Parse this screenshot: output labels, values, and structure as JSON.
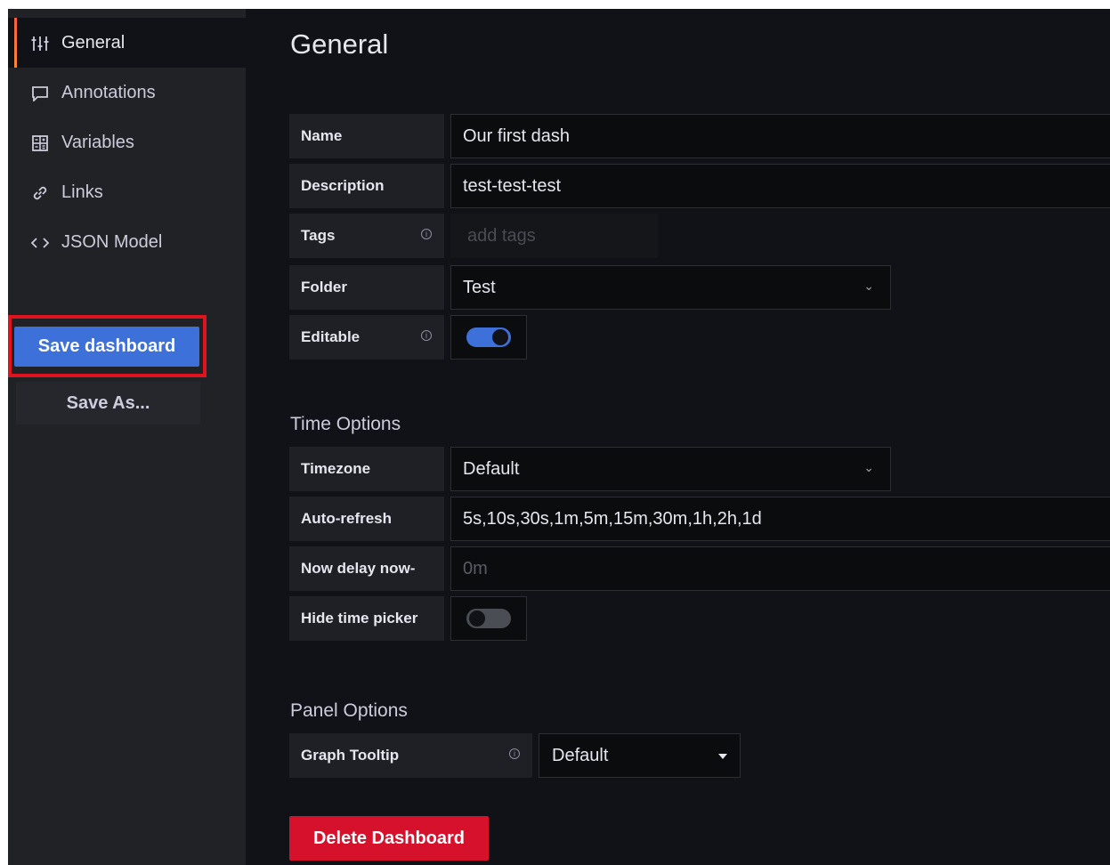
{
  "sidebar": {
    "items": [
      {
        "label": "General",
        "icon": "sliders-icon",
        "active": true
      },
      {
        "label": "Annotations",
        "icon": "comment-icon"
      },
      {
        "label": "Variables",
        "icon": "calculator-icon"
      },
      {
        "label": "Links",
        "icon": "link-icon"
      },
      {
        "label": "JSON Model",
        "icon": "code-icon"
      }
    ],
    "save_label": "Save dashboard",
    "save_as_label": "Save As..."
  },
  "main": {
    "title": "General",
    "general": {
      "name_label": "Name",
      "name_value": "Our first dash",
      "description_label": "Description",
      "description_value": "test-test-test",
      "tags_label": "Tags",
      "tags_placeholder": "add tags",
      "folder_label": "Folder",
      "folder_value": "Test",
      "editable_label": "Editable",
      "editable_on": true
    },
    "time_options": {
      "title": "Time Options",
      "timezone_label": "Timezone",
      "timezone_value": "Default",
      "autorefresh_label": "Auto-refresh",
      "autorefresh_value": "5s,10s,30s,1m,5m,15m,30m,1h,2h,1d",
      "nowdelay_label": "Now delay now-",
      "nowdelay_placeholder": "0m",
      "hide_picker_label": "Hide time picker",
      "hide_picker_on": false
    },
    "panel_options": {
      "title": "Panel Options",
      "graph_tooltip_label": "Graph Tooltip",
      "graph_tooltip_value": "Default"
    },
    "delete_label": "Delete Dashboard"
  },
  "colors": {
    "primary": "#3d71d9",
    "danger": "#d5112b",
    "highlight": "#e0141e",
    "active_accent": "#ff8833"
  }
}
